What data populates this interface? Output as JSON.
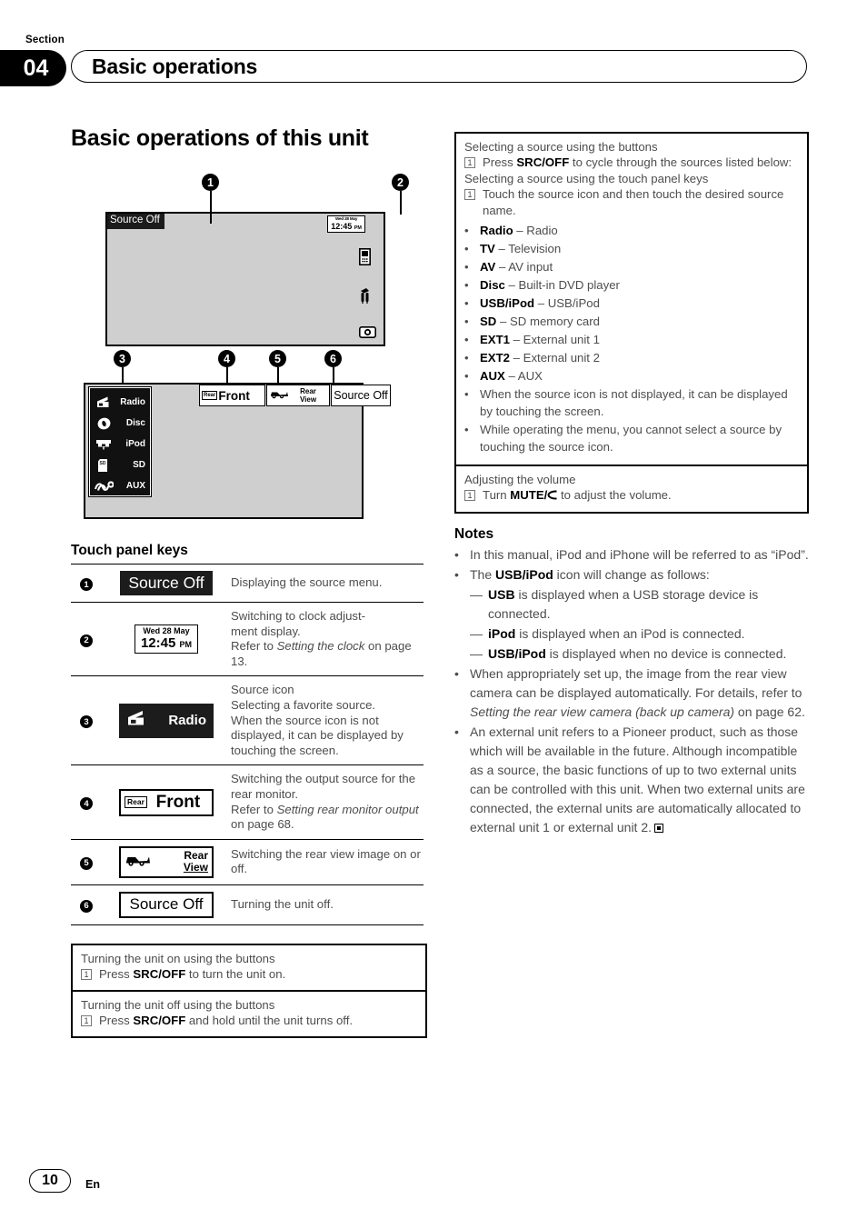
{
  "header": {
    "section_word": "Section",
    "section_number": "04",
    "section_title": "Basic operations"
  },
  "page_title": "Basic operations of this unit",
  "figure1": {
    "callouts": [
      "1",
      "2"
    ],
    "source_off_label": "Source Off",
    "clock": {
      "date": "Wed 28 May",
      "time": "12:45",
      "meridiem": "PM"
    },
    "side_icons": [
      "phone-icon",
      "tools-icon",
      "camera-icon"
    ]
  },
  "figure2": {
    "callouts": [
      "3",
      "4",
      "5",
      "6"
    ],
    "source_menu": [
      {
        "icon": "radio-icon",
        "label": "Radio"
      },
      {
        "icon": "disc-icon",
        "label": "Disc"
      },
      {
        "icon": "ipod-icon",
        "label": "iPod"
      },
      {
        "icon": "sd-icon",
        "label": "SD"
      },
      {
        "icon": "aux-icon",
        "label": "AUX"
      }
    ],
    "top_buttons": {
      "rear_tag": "Rear",
      "front_label": "Front",
      "rear_label": "Rear",
      "view_label": "View",
      "source_off_label": "Source Off"
    }
  },
  "touch_panel": {
    "heading": "Touch panel keys",
    "rows": [
      {
        "num": "1",
        "key_type": "source-off-black",
        "key_label": "Source Off",
        "desc": "Displaying the source menu."
      },
      {
        "num": "2",
        "key_type": "clock",
        "clock": {
          "date": "Wed 28 May",
          "time": "12:45",
          "meridiem": "PM"
        },
        "desc_line1": "Switching to clock adjust-",
        "desc_line2": "ment display.",
        "desc_line3_pre": "Refer to ",
        "desc_line3_italic": "Setting the clock",
        "desc_line3_post": " on page 13."
      },
      {
        "num": "3",
        "key_type": "radio-black",
        "key_label": "Radio",
        "desc_line1": "Source icon",
        "desc_line2": "Selecting a favorite source.",
        "desc_line3": "When the source icon is not displayed, it can be displayed by touching the screen."
      },
      {
        "num": "4",
        "key_type": "rear-front",
        "rear_tag": "Rear",
        "key_label": "Front",
        "desc_line1": "Switching the output source for the rear monitor.",
        "desc_line2_pre": "Refer to ",
        "desc_line2_italic": "Setting rear monitor output",
        "desc_line2_post": " on page 68."
      },
      {
        "num": "5",
        "key_type": "rear-view",
        "key_label_1": "Rear",
        "key_label_2": "View",
        "desc": "Switching the rear view image on or off."
      },
      {
        "num": "6",
        "key_type": "source-off-outline",
        "key_label": "Source Off",
        "desc": "Turning the unit off."
      }
    ]
  },
  "left_boxes": [
    {
      "head": "Turning the unit on using the buttons",
      "step_num": "1",
      "step_pre": "Press ",
      "step_bold": "SRC/OFF",
      "step_post": " to turn the unit on."
    },
    {
      "head": "Turning the unit off using the buttons",
      "step_num": "1",
      "step_pre": "Press ",
      "step_bold": "SRC/OFF",
      "step_post": " and hold until the unit turns off."
    }
  ],
  "source_box": {
    "head1": "Selecting a source using the buttons",
    "step1_num": "1",
    "step1_pre": "Press ",
    "step1_bold": "SRC/OFF",
    "step1_post": " to cycle through the sources listed below:",
    "head2": "Selecting a source using the touch panel keys",
    "step2_num": "1",
    "step2_text": "Touch the source icon and then touch the desired source name.",
    "sources": [
      {
        "name": "Radio",
        "desc": " – Radio"
      },
      {
        "name": "TV",
        "desc": " – Television"
      },
      {
        "name": "AV",
        "desc": " – AV input"
      },
      {
        "name": "Disc",
        "desc": " – Built-in DVD player"
      },
      {
        "name": "USB/iPod",
        "desc": " – USB/iPod"
      },
      {
        "name": "SD",
        "desc": " – SD memory card"
      },
      {
        "name": "EXT1",
        "desc": " – External unit 1"
      },
      {
        "name": "EXT2",
        "desc": " – External unit 2"
      },
      {
        "name": "AUX",
        "desc": " – AUX"
      }
    ],
    "extra_bullets": [
      "When the source icon is not displayed, it can be displayed by touching the screen.",
      "While operating the menu, you cannot select a source by touching the source icon."
    ]
  },
  "volume_box": {
    "head": "Adjusting the volume",
    "step_num": "1",
    "step_pre": "Turn ",
    "step_bold": "MUTE/",
    "step_icon": "volume-knob-icon",
    "step_post": " to adjust the volume."
  },
  "notes": {
    "heading": "Notes",
    "items": [
      {
        "text": "In this manual, iPod and iPhone will be referred to as “iPod”."
      },
      {
        "pre": "The ",
        "bold": "USB/iPod",
        "post": " icon will change as follows:",
        "subitems": [
          {
            "bold": "USB",
            "post": " is displayed when a USB storage device is connected."
          },
          {
            "bold": "iPod",
            "post": " is displayed when an iPod is connected."
          },
          {
            "bold": "USB/iPod",
            "post": " is displayed when no device is connected."
          }
        ]
      },
      {
        "pre": "When appropriately set up, the image from the rear view camera can be displayed automatically. For details, refer to ",
        "italic": "Setting the rear view camera (back up camera)",
        "post": " on page 62."
      },
      {
        "text": "An external unit refers to a Pioneer product, such as those which will be available in the future. Although incompatible as a source, the basic functions of up to two external units can be controlled with this unit. When two external units are connected, the external units are automatically allocated to external unit 1 or external unit 2.",
        "endmark": true
      }
    ]
  },
  "footer": {
    "page_number": "10",
    "language": "En"
  }
}
